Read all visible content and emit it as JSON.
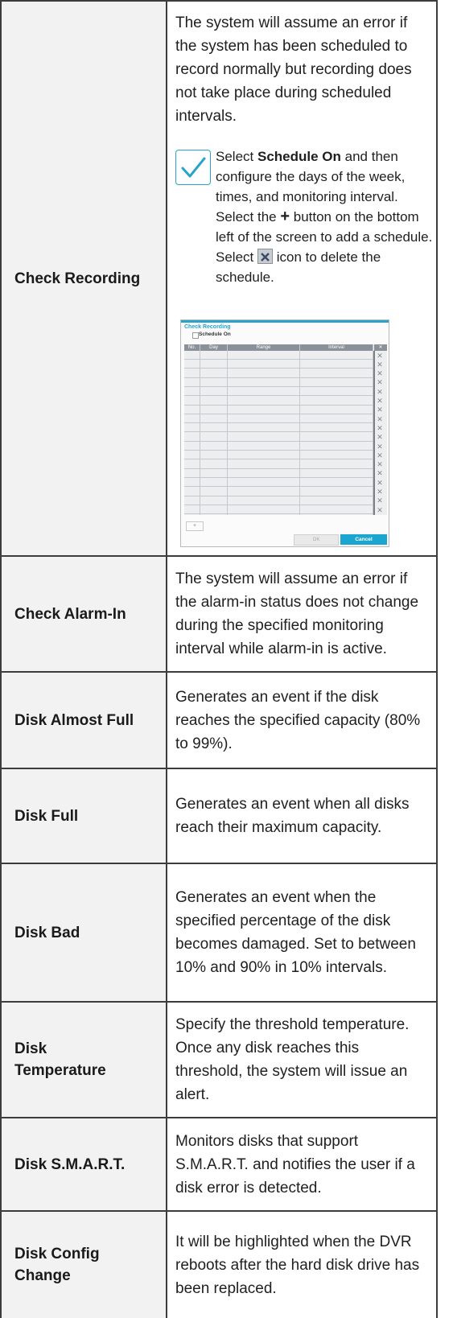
{
  "rows": [
    {
      "label": "Check Recording",
      "description": "The system will assume an error if the system has been scheduled to record normally but recording does not take place during scheduled intervals.",
      "note": {
        "select": "Select ",
        "bold": "Schedule On",
        "part1": " and then configure the days of the week, times, and monitoring interval. Select the ",
        "plus": "+",
        "part2": " button on the bottom left of the screen to add a schedule. Select ",
        "part3": " icon to delete the schedule."
      },
      "dialog": {
        "title": "Check Recording",
        "schedule_on": "Schedule On",
        "columns": [
          "No.",
          "Day",
          "Range",
          "Interval"
        ],
        "row_count": 18,
        "add_label": "+",
        "ok_label": "OK",
        "cancel_label": "Cancel"
      }
    },
    {
      "label": "Check Alarm-In",
      "description": "The system will assume an error if the alarm-in status does not change during the specified monitoring interval while alarm-in is active."
    },
    {
      "label": "Disk Almost Full",
      "description": "Generates an event if the disk reaches the specified capacity (80% to 99%)."
    },
    {
      "label": "Disk Full",
      "description": "Generates an event when all disks reach their maximum capacity."
    },
    {
      "label": "Disk Bad",
      "description": "Generates an event when the specified percentage of the disk becomes damaged. Set to between 10% and 90% in 10% intervals."
    },
    {
      "label": "Disk Temperature",
      "description": "Specify the threshold temperature. Once any disk reaches this threshold, the system will issue an alert."
    },
    {
      "label": "Disk S.M.A.R.T.",
      "description": "Monitors disks that support S.M.A.R.T. and notifies the user if a disk error is detected."
    },
    {
      "label": "Disk Config Change",
      "description": "It will be highlighted when the DVR reboots after the hard disk drive has been replaced."
    }
  ],
  "colors": {
    "accent": "#2aa3c8",
    "border": "#3c3c3c",
    "label_bg": "#f2f2f2"
  },
  "icons": [
    "checkmark-note-icon",
    "plus-icon",
    "delete-x-icon"
  ]
}
